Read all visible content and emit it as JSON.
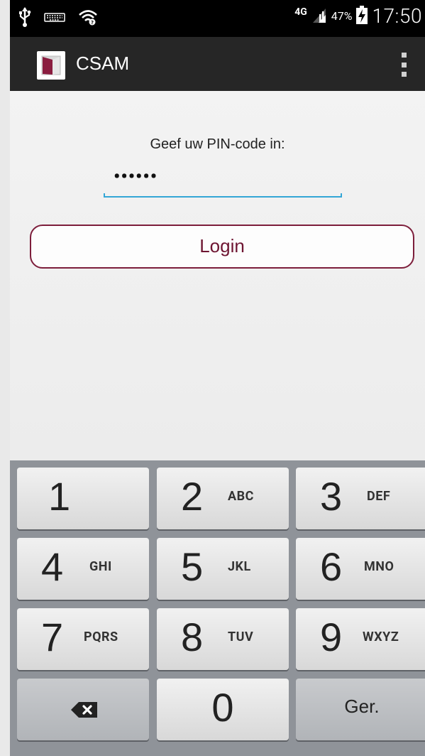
{
  "status_bar": {
    "network": "4G",
    "battery": "47%",
    "time": "17:50"
  },
  "action_bar": {
    "title": "CSAM"
  },
  "content": {
    "pin_label": "Geef uw PIN-code in:",
    "pin_value": "••••••",
    "login_label": "Login"
  },
  "keyboard": {
    "keys": [
      {
        "num": "1",
        "letters": ""
      },
      {
        "num": "2",
        "letters": "ABC"
      },
      {
        "num": "3",
        "letters": "DEF"
      },
      {
        "num": "4",
        "letters": "GHI"
      },
      {
        "num": "5",
        "letters": "JKL"
      },
      {
        "num": "6",
        "letters": "MNO"
      },
      {
        "num": "7",
        "letters": "PQRS"
      },
      {
        "num": "8",
        "letters": "TUV"
      },
      {
        "num": "9",
        "letters": "WXYZ"
      },
      {
        "num": "0",
        "letters": ""
      }
    ],
    "done_label": "Ger."
  },
  "colors": {
    "accent_underline": "#33a6d6",
    "brand_maroon": "#7d1e3b",
    "action_bar": "#262626"
  },
  "icons": [
    "usb-icon",
    "keyboard-icon",
    "wifi-icon",
    "signal-icon",
    "battery-charging-icon",
    "app-logo-icon",
    "overflow-menu-icon",
    "backspace-icon"
  ]
}
